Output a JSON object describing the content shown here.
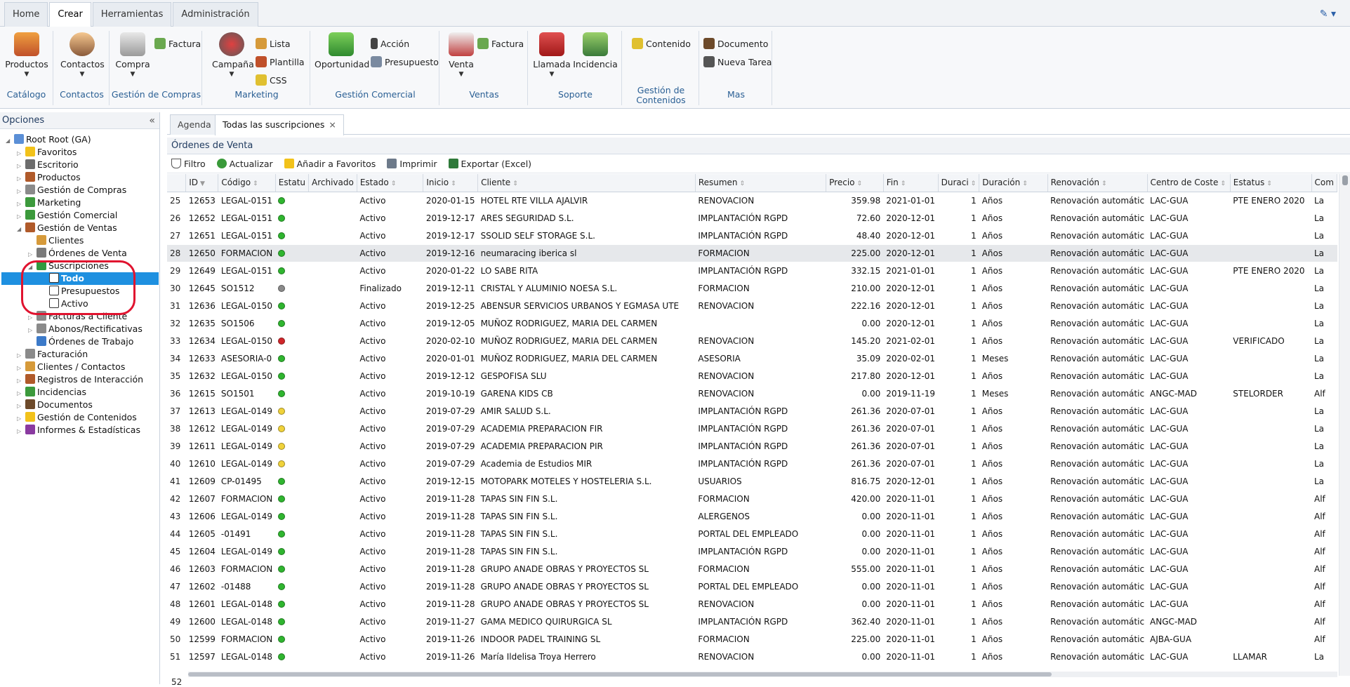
{
  "top_tabs": [
    "Home",
    "Crear",
    "Herramientas",
    "Administración"
  ],
  "active_top_tab": "Crear",
  "ribbon": {
    "catalogo": {
      "title": "Catálogo",
      "productos": "Productos"
    },
    "contactos": {
      "title": "Contactos",
      "contactos": "Contactos"
    },
    "compras": {
      "title": "Gestión de Compras",
      "compra": "Compra",
      "factura": "Factura"
    },
    "marketing": {
      "title": "Marketing",
      "campana": "Campaña",
      "lista": "Lista",
      "plantilla": "Plantilla",
      "css": "CSS"
    },
    "comercial": {
      "title": "Gestión Comercial",
      "oportunidad": "Oportunidad",
      "accion": "Acción",
      "presupuesto": "Presupuesto"
    },
    "ventas": {
      "title": "Ventas",
      "venta": "Venta",
      "factura": "Factura"
    },
    "soporte": {
      "title": "Soporte",
      "llamada": "Llamada",
      "incidencia": "Incidencia"
    },
    "contenidos": {
      "title": "Gestión de Contenidos",
      "contenido": "Contenido"
    },
    "mas": {
      "title": "Mas",
      "documento": "Documento",
      "nueva_tarea": "Nueva Tarea"
    }
  },
  "left_panel": {
    "title": "Opciones",
    "tree": [
      {
        "label": "Root Root (GA)",
        "icon": "computer-icon",
        "exp": "◢",
        "color": "#5b8fd6"
      },
      {
        "label": "Favoritos",
        "icon": "star-icon",
        "exp": "▷",
        "color": "#f2c21a"
      },
      {
        "label": "Escritorio",
        "icon": "desktop-icon",
        "exp": "▷",
        "color": "#6d6d6d"
      },
      {
        "label": "Productos",
        "icon": "box-icon",
        "exp": "▷",
        "color": "#b05a2a"
      },
      {
        "label": "Gestión de Compras",
        "icon": "purchase-icon",
        "exp": "▷",
        "color": "#8a8a8a"
      },
      {
        "label": "Marketing",
        "icon": "marketing-icon",
        "exp": "▷",
        "color": "#3c9a3c"
      },
      {
        "label": "Gestión Comercial",
        "icon": "sales-icon",
        "exp": "▷",
        "color": "#3c9a3c"
      },
      {
        "label": "Gestión de Ventas",
        "icon": "sales-management-icon",
        "exp": "◢",
        "color": "#b05a2a"
      },
      {
        "label": "Clientes",
        "icon": "clients-icon",
        "exp": "",
        "color": "#d69a3a"
      },
      {
        "label": "Órdenes de Venta",
        "icon": "orders-icon",
        "exp": "▷",
        "color": "#7a7a7a"
      },
      {
        "label": "Suscripciones",
        "icon": "subscription-icon",
        "exp": "◢",
        "color": "#2f9a3f"
      },
      {
        "label": "Todo",
        "icon": "document-icon",
        "exp": "",
        "color": "#ffffff"
      },
      {
        "label": "Presupuestos",
        "icon": "document-icon",
        "exp": "",
        "color": "#ffffff"
      },
      {
        "label": "Activo",
        "icon": "document-icon",
        "exp": "",
        "color": "#ffffff"
      },
      {
        "label": "Facturas a Cliente",
        "icon": "invoice-icon",
        "exp": "▷",
        "color": "#8a8a8a"
      },
      {
        "label": "Abonos/Rectificativas",
        "icon": "credit-note-icon",
        "exp": "▷",
        "color": "#8a8a8a"
      },
      {
        "label": "Órdenes de Trabajo",
        "icon": "work-order-icon",
        "exp": "",
        "color": "#3c7ac9"
      },
      {
        "label": "Facturación",
        "icon": "billing-icon",
        "exp": "▷",
        "color": "#8a8a8a"
      },
      {
        "label": "Clientes / Contactos",
        "icon": "contacts-icon",
        "exp": "▷",
        "color": "#d69a3a"
      },
      {
        "label": "Registros de Interacción",
        "icon": "interaction-icon",
        "exp": "▷",
        "color": "#b05a2a"
      },
      {
        "label": "Incidencias",
        "icon": "incident-icon",
        "exp": "▷",
        "color": "#3c9a3c"
      },
      {
        "label": "Documentos",
        "icon": "documents-icon",
        "exp": "▷",
        "color": "#6d4a2a"
      },
      {
        "label": "Gestión de Contenidos",
        "icon": "content-icon",
        "exp": "▷",
        "color": "#f2c21a"
      },
      {
        "label": "Informes & Estadísticas",
        "icon": "reports-icon",
        "exp": "▷",
        "color": "#8a3aa0"
      }
    ],
    "selected": "Todo"
  },
  "subtabs": {
    "agenda": "Agenda",
    "todas": "Todas las suscripciones",
    "close": "×"
  },
  "section_title": "Órdenes de Venta",
  "toolbar": {
    "filtro": "Filtro",
    "actualizar": "Actualizar",
    "favoritos": "Añadir a Favoritos",
    "imprimir": "Imprimir",
    "exportar": "Exportar (Excel)"
  },
  "columns": [
    "",
    "ID",
    "Código",
    "Estatu",
    "Archivado",
    "Estado",
    "Inicio",
    "Cliente",
    "Resumen",
    "Precio",
    "Fin",
    "Duraci",
    "Duración",
    "Renovación",
    "Centro de Coste",
    "Estatus",
    "Com"
  ],
  "status_colors": {
    "green": "#2fb52f",
    "grey": "#8a8a8a",
    "red": "#d0262a",
    "yellow": "#f0d23a"
  },
  "rows": [
    {
      "n": "25",
      "id": "12653",
      "code": "LEGAL-0151",
      "dot": "green",
      "estado": "Activo",
      "inicio": "2020-01-15",
      "cliente": "HOTEL RTE VILLA AJALVIR",
      "resumen": "RENOVACION",
      "precio": "359.98",
      "fin": "2021-01-01",
      "dur": "1",
      "duracion": "Años",
      "renov": "Renovación automátic",
      "centro": "LAC-GUA",
      "estatus": "PTE ENERO 2020",
      "com": "La"
    },
    {
      "n": "26",
      "id": "12652",
      "code": "LEGAL-0151",
      "dot": "green",
      "estado": "Activo",
      "inicio": "2019-12-17",
      "cliente": "ARES SEGURIDAD S.L.",
      "resumen": "IMPLANTACIÓN RGPD",
      "precio": "72.60",
      "fin": "2020-12-01",
      "dur": "1",
      "duracion": "Años",
      "renov": "Renovación automátic",
      "centro": "LAC-GUA",
      "estatus": "",
      "com": "La"
    },
    {
      "n": "27",
      "id": "12651",
      "code": "LEGAL-0151",
      "dot": "green",
      "estado": "Activo",
      "inicio": "2019-12-17",
      "cliente": "SSOLID SELF STORAGE S.L.",
      "resumen": "IMPLANTACIÓN RGPD",
      "precio": "48.40",
      "fin": "2020-12-01",
      "dur": "1",
      "duracion": "Años",
      "renov": "Renovación automátic",
      "centro": "LAC-GUA",
      "estatus": "",
      "com": "La"
    },
    {
      "n": "28",
      "id": "12650",
      "code": "FORMACION",
      "dot": "green",
      "estado": "Activo",
      "inicio": "2019-12-16",
      "cliente": "neumaracing iberica sl",
      "resumen": "FORMACION",
      "precio": "225.00",
      "fin": "2020-12-01",
      "dur": "1",
      "duracion": "Años",
      "renov": "Renovación automátic",
      "centro": "LAC-GUA",
      "estatus": "",
      "com": "La",
      "hl": true
    },
    {
      "n": "29",
      "id": "12649",
      "code": "LEGAL-0151",
      "dot": "green",
      "estado": "Activo",
      "inicio": "2020-01-22",
      "cliente": "LO SABE RITA",
      "resumen": "IMPLANTACIÓN RGPD",
      "precio": "332.15",
      "fin": "2021-01-01",
      "dur": "1",
      "duracion": "Años",
      "renov": "Renovación automátic",
      "centro": "LAC-GUA",
      "estatus": "PTE ENERO 2020",
      "com": "La"
    },
    {
      "n": "30",
      "id": "12645",
      "code": "SO1512",
      "dot": "grey",
      "estado": "Finalizado",
      "inicio": "2019-12-11",
      "cliente": "CRISTAL Y ALUMINIO NOESA S.L.",
      "resumen": "FORMACION",
      "precio": "210.00",
      "fin": "2020-12-01",
      "dur": "1",
      "duracion": "Años",
      "renov": "Renovación automátic",
      "centro": "LAC-GUA",
      "estatus": "",
      "com": "La"
    },
    {
      "n": "31",
      "id": "12636",
      "code": "LEGAL-0150",
      "dot": "green",
      "estado": "Activo",
      "inicio": "2019-12-25",
      "cliente": "ABENSUR SERVICIOS URBANOS Y EGMASA UTE",
      "resumen": "RENOVACION",
      "precio": "222.16",
      "fin": "2020-12-01",
      "dur": "1",
      "duracion": "Años",
      "renov": "Renovación automátic",
      "centro": "LAC-GUA",
      "estatus": "",
      "com": "La"
    },
    {
      "n": "32",
      "id": "12635",
      "code": "SO1506",
      "dot": "green",
      "estado": "Activo",
      "inicio": "2019-12-05",
      "cliente": "MUÑOZ RODRIGUEZ, MARIA DEL CARMEN",
      "resumen": "",
      "precio": "0.00",
      "fin": "2020-12-01",
      "dur": "1",
      "duracion": "Años",
      "renov": "Renovación automátic",
      "centro": "LAC-GUA",
      "estatus": "",
      "com": "La"
    },
    {
      "n": "33",
      "id": "12634",
      "code": "LEGAL-0150",
      "dot": "red",
      "estado": "Activo",
      "inicio": "2020-02-10",
      "cliente": "MUÑOZ RODRIGUEZ, MARIA DEL CARMEN",
      "resumen": "RENOVACION",
      "precio": "145.20",
      "fin": "2021-02-01",
      "dur": "1",
      "duracion": "Años",
      "renov": "Renovación automátic",
      "centro": "LAC-GUA",
      "estatus": "VERIFICADO",
      "com": "La"
    },
    {
      "n": "34",
      "id": "12633",
      "code": "ASESORIA-0",
      "dot": "green",
      "estado": "Activo",
      "inicio": "2020-01-01",
      "cliente": "MUÑOZ RODRIGUEZ, MARIA DEL CARMEN",
      "resumen": "ASESORIA",
      "precio": "35.09",
      "fin": "2020-02-01",
      "dur": "1",
      "duracion": "Meses",
      "renov": "Renovación automátic",
      "centro": "LAC-GUA",
      "estatus": "",
      "com": "La"
    },
    {
      "n": "35",
      "id": "12632",
      "code": "LEGAL-0150",
      "dot": "green",
      "estado": "Activo",
      "inicio": "2019-12-12",
      "cliente": "GESPOFISA SLU",
      "resumen": "RENOVACION",
      "precio": "217.80",
      "fin": "2020-12-01",
      "dur": "1",
      "duracion": "Años",
      "renov": "Renovación automátic",
      "centro": "LAC-GUA",
      "estatus": "",
      "com": "La"
    },
    {
      "n": "36",
      "id": "12615",
      "code": "SO1501",
      "dot": "green",
      "estado": "Activo",
      "inicio": "2019-10-19",
      "cliente": "GARENA KIDS CB",
      "resumen": "RENOVACION",
      "precio": "0.00",
      "fin": "2019-11-19",
      "dur": "1",
      "duracion": "Meses",
      "renov": "Renovación automátic",
      "centro": "ANGC-MAD",
      "estatus": "STELORDER",
      "com": "Alf"
    },
    {
      "n": "37",
      "id": "12613",
      "code": "LEGAL-0149",
      "dot": "yellow",
      "estado": "Activo",
      "inicio": "2019-07-29",
      "cliente": "AMIR SALUD S.L.",
      "resumen": "IMPLANTACIÓN RGPD",
      "precio": "261.36",
      "fin": "2020-07-01",
      "dur": "1",
      "duracion": "Años",
      "renov": "Renovación automátic",
      "centro": "LAC-GUA",
      "estatus": "",
      "com": "La"
    },
    {
      "n": "38",
      "id": "12612",
      "code": "LEGAL-0149",
      "dot": "yellow",
      "estado": "Activo",
      "inicio": "2019-07-29",
      "cliente": "ACADEMIA PREPARACION FIR",
      "resumen": "IMPLANTACIÓN RGPD",
      "precio": "261.36",
      "fin": "2020-07-01",
      "dur": "1",
      "duracion": "Años",
      "renov": "Renovación automátic",
      "centro": "LAC-GUA",
      "estatus": "",
      "com": "La"
    },
    {
      "n": "39",
      "id": "12611",
      "code": "LEGAL-0149",
      "dot": "yellow",
      "estado": "Activo",
      "inicio": "2019-07-29",
      "cliente": "ACADEMIA PREPARACION PIR",
      "resumen": "IMPLANTACIÓN RGPD",
      "precio": "261.36",
      "fin": "2020-07-01",
      "dur": "1",
      "duracion": "Años",
      "renov": "Renovación automátic",
      "centro": "LAC-GUA",
      "estatus": "",
      "com": "La"
    },
    {
      "n": "40",
      "id": "12610",
      "code": "LEGAL-0149",
      "dot": "yellow",
      "estado": "Activo",
      "inicio": "2019-07-29",
      "cliente": "Academia de Estudios MIR",
      "resumen": "IMPLANTACIÓN RGPD",
      "precio": "261.36",
      "fin": "2020-07-01",
      "dur": "1",
      "duracion": "Años",
      "renov": "Renovación automátic",
      "centro": "LAC-GUA",
      "estatus": "",
      "com": "La"
    },
    {
      "n": "41",
      "id": "12609",
      "code": "CP-01495",
      "dot": "green",
      "estado": "Activo",
      "inicio": "2019-12-15",
      "cliente": "MOTOPARK MOTELES Y HOSTELERIA S.L.",
      "resumen": "USUARIOS",
      "precio": "816.75",
      "fin": "2020-12-01",
      "dur": "1",
      "duracion": "Años",
      "renov": "Renovación automátic",
      "centro": "LAC-GUA",
      "estatus": "",
      "com": "La"
    },
    {
      "n": "42",
      "id": "12607",
      "code": "FORMACION",
      "dot": "green",
      "estado": "Activo",
      "inicio": "2019-11-28",
      "cliente": "TAPAS SIN FIN S.L.",
      "resumen": "FORMACION",
      "precio": "420.00",
      "fin": "2020-11-01",
      "dur": "1",
      "duracion": "Años",
      "renov": "Renovación automátic",
      "centro": "LAC-GUA",
      "estatus": "",
      "com": "Alf"
    },
    {
      "n": "43",
      "id": "12606",
      "code": "LEGAL-0149",
      "dot": "green",
      "estado": "Activo",
      "inicio": "2019-11-28",
      "cliente": "TAPAS SIN FIN S.L.",
      "resumen": "ALERGENOS",
      "precio": "0.00",
      "fin": "2020-11-01",
      "dur": "1",
      "duracion": "Años",
      "renov": "Renovación automátic",
      "centro": "LAC-GUA",
      "estatus": "",
      "com": "Alf"
    },
    {
      "n": "44",
      "id": "12605",
      "code": "-01491",
      "dot": "green",
      "estado": "Activo",
      "inicio": "2019-11-28",
      "cliente": "TAPAS SIN FIN S.L.",
      "resumen": "PORTAL DEL EMPLEADO",
      "precio": "0.00",
      "fin": "2020-11-01",
      "dur": "1",
      "duracion": "Años",
      "renov": "Renovación automátic",
      "centro": "LAC-GUA",
      "estatus": "",
      "com": "Alf"
    },
    {
      "n": "45",
      "id": "12604",
      "code": "LEGAL-0149",
      "dot": "green",
      "estado": "Activo",
      "inicio": "2019-11-28",
      "cliente": "TAPAS SIN FIN S.L.",
      "resumen": "IMPLANTACIÓN RGPD",
      "precio": "0.00",
      "fin": "2020-11-01",
      "dur": "1",
      "duracion": "Años",
      "renov": "Renovación automátic",
      "centro": "LAC-GUA",
      "estatus": "",
      "com": "Alf"
    },
    {
      "n": "46",
      "id": "12603",
      "code": "FORMACION",
      "dot": "green",
      "estado": "Activo",
      "inicio": "2019-11-28",
      "cliente": "GRUPO ANADE OBRAS Y PROYECTOS SL",
      "resumen": "FORMACION",
      "precio": "555.00",
      "fin": "2020-11-01",
      "dur": "1",
      "duracion": "Años",
      "renov": "Renovación automátic",
      "centro": "LAC-GUA",
      "estatus": "",
      "com": "Alf"
    },
    {
      "n": "47",
      "id": "12602",
      "code": "-01488",
      "dot": "green",
      "estado": "Activo",
      "inicio": "2019-11-28",
      "cliente": "GRUPO ANADE OBRAS Y PROYECTOS SL",
      "resumen": "PORTAL DEL EMPLEADO",
      "precio": "0.00",
      "fin": "2020-11-01",
      "dur": "1",
      "duracion": "Años",
      "renov": "Renovación automátic",
      "centro": "LAC-GUA",
      "estatus": "",
      "com": "Alf"
    },
    {
      "n": "48",
      "id": "12601",
      "code": "LEGAL-0148",
      "dot": "green",
      "estado": "Activo",
      "inicio": "2019-11-28",
      "cliente": "GRUPO ANADE OBRAS Y PROYECTOS SL",
      "resumen": "RENOVACION",
      "precio": "0.00",
      "fin": "2020-11-01",
      "dur": "1",
      "duracion": "Años",
      "renov": "Renovación automátic",
      "centro": "LAC-GUA",
      "estatus": "",
      "com": "Alf"
    },
    {
      "n": "49",
      "id": "12600",
      "code": "LEGAL-0148",
      "dot": "green",
      "estado": "Activo",
      "inicio": "2019-11-27",
      "cliente": "GAMA MEDICO QUIRURGICA SL",
      "resumen": "IMPLANTACIÓN RGPD",
      "precio": "362.40",
      "fin": "2020-11-01",
      "dur": "1",
      "duracion": "Años",
      "renov": "Renovación automátic",
      "centro": "ANGC-MAD",
      "estatus": "",
      "com": "Alf"
    },
    {
      "n": "50",
      "id": "12599",
      "code": "FORMACION",
      "dot": "green",
      "estado": "Activo",
      "inicio": "2019-11-26",
      "cliente": "INDOOR PADEL TRAINING SL",
      "resumen": "FORMACION",
      "precio": "225.00",
      "fin": "2020-11-01",
      "dur": "1",
      "duracion": "Años",
      "renov": "Renovación automátic",
      "centro": "AJBA-GUA",
      "estatus": "",
      "com": "Alf"
    },
    {
      "n": "51",
      "id": "12597",
      "code": "LEGAL-0148",
      "dot": "green",
      "estado": "Activo",
      "inicio": "2019-11-26",
      "cliente": "María Ildelisa Troya Herrero",
      "resumen": "RENOVACION",
      "precio": "0.00",
      "fin": "2020-11-01",
      "dur": "1",
      "duracion": "Años",
      "renov": "Renovación automátic",
      "centro": "LAC-GUA",
      "estatus": "LLAMAR",
      "com": "La"
    }
  ],
  "next_row_number": "52"
}
